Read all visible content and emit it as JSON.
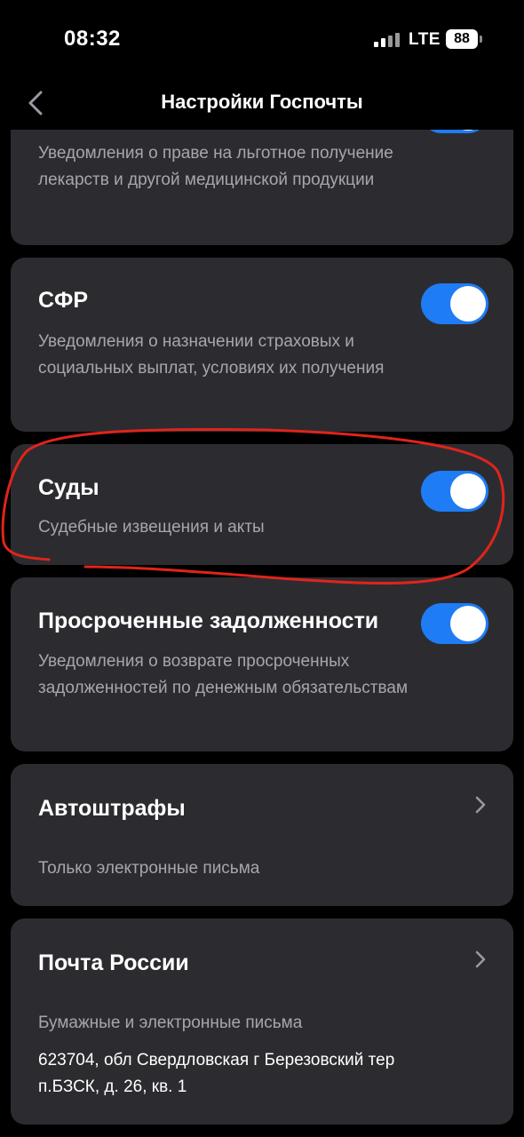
{
  "status_bar": {
    "time": "08:32",
    "network": "LTE",
    "battery": "88"
  },
  "header": {
    "title": "Настройки Госпочты"
  },
  "cards": [
    {
      "description": "Уведомления о праве на льготное получение лекарств и другой медицинской продукции",
      "toggle_on": true
    },
    {
      "title": "СФР",
      "description": "Уведомления о назначении страховых и социальных выплат, условиях их получения",
      "toggle_on": true
    },
    {
      "title": "Суды",
      "description": "Судебные извещения и акты",
      "toggle_on": true
    },
    {
      "title": "Просроченные задолженности",
      "description": "Уведомления о возврате просроченных задолженностей по денежным обязательствам",
      "toggle_on": true
    },
    {
      "title": "Автоштрафы",
      "description": "Только электронные письма"
    },
    {
      "title": "Почта России",
      "description": "Бумажные и электронные письма",
      "address": "623704, обл Свердловская г Березовский тер п.БЗСК, д. 26, кв. 1"
    }
  ],
  "colors": {
    "background": "#000000",
    "card": "#2c2c30",
    "toggle_on": "#1e7cf5",
    "secondary_text": "#a6a6ae",
    "annotation": "#e0241b"
  }
}
